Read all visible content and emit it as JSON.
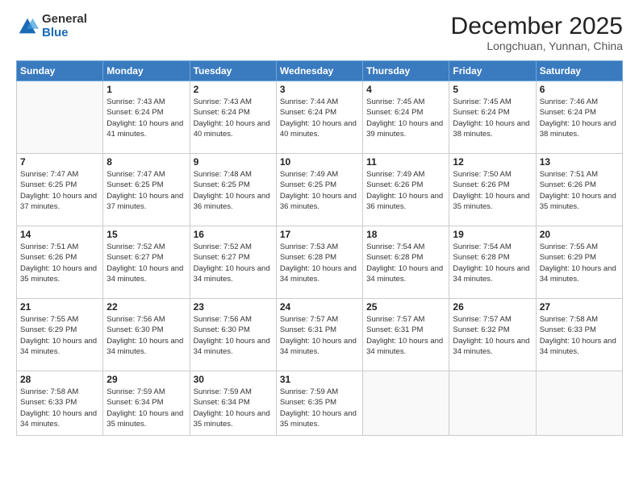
{
  "logo": {
    "general": "General",
    "blue": "Blue"
  },
  "header": {
    "month": "December 2025",
    "location": "Longchuan, Yunnan, China"
  },
  "weekdays": [
    "Sunday",
    "Monday",
    "Tuesday",
    "Wednesday",
    "Thursday",
    "Friday",
    "Saturday"
  ],
  "weeks": [
    [
      {
        "day": "",
        "sunrise": "",
        "sunset": "",
        "daylight": ""
      },
      {
        "day": "1",
        "sunrise": "Sunrise: 7:43 AM",
        "sunset": "Sunset: 6:24 PM",
        "daylight": "Daylight: 10 hours and 41 minutes."
      },
      {
        "day": "2",
        "sunrise": "Sunrise: 7:43 AM",
        "sunset": "Sunset: 6:24 PM",
        "daylight": "Daylight: 10 hours and 40 minutes."
      },
      {
        "day": "3",
        "sunrise": "Sunrise: 7:44 AM",
        "sunset": "Sunset: 6:24 PM",
        "daylight": "Daylight: 10 hours and 40 minutes."
      },
      {
        "day": "4",
        "sunrise": "Sunrise: 7:45 AM",
        "sunset": "Sunset: 6:24 PM",
        "daylight": "Daylight: 10 hours and 39 minutes."
      },
      {
        "day": "5",
        "sunrise": "Sunrise: 7:45 AM",
        "sunset": "Sunset: 6:24 PM",
        "daylight": "Daylight: 10 hours and 38 minutes."
      },
      {
        "day": "6",
        "sunrise": "Sunrise: 7:46 AM",
        "sunset": "Sunset: 6:24 PM",
        "daylight": "Daylight: 10 hours and 38 minutes."
      }
    ],
    [
      {
        "day": "7",
        "sunrise": "Sunrise: 7:47 AM",
        "sunset": "Sunset: 6:25 PM",
        "daylight": "Daylight: 10 hours and 37 minutes."
      },
      {
        "day": "8",
        "sunrise": "Sunrise: 7:47 AM",
        "sunset": "Sunset: 6:25 PM",
        "daylight": "Daylight: 10 hours and 37 minutes."
      },
      {
        "day": "9",
        "sunrise": "Sunrise: 7:48 AM",
        "sunset": "Sunset: 6:25 PM",
        "daylight": "Daylight: 10 hours and 36 minutes."
      },
      {
        "day": "10",
        "sunrise": "Sunrise: 7:49 AM",
        "sunset": "Sunset: 6:25 PM",
        "daylight": "Daylight: 10 hours and 36 minutes."
      },
      {
        "day": "11",
        "sunrise": "Sunrise: 7:49 AM",
        "sunset": "Sunset: 6:26 PM",
        "daylight": "Daylight: 10 hours and 36 minutes."
      },
      {
        "day": "12",
        "sunrise": "Sunrise: 7:50 AM",
        "sunset": "Sunset: 6:26 PM",
        "daylight": "Daylight: 10 hours and 35 minutes."
      },
      {
        "day": "13",
        "sunrise": "Sunrise: 7:51 AM",
        "sunset": "Sunset: 6:26 PM",
        "daylight": "Daylight: 10 hours and 35 minutes."
      }
    ],
    [
      {
        "day": "14",
        "sunrise": "Sunrise: 7:51 AM",
        "sunset": "Sunset: 6:26 PM",
        "daylight": "Daylight: 10 hours and 35 minutes."
      },
      {
        "day": "15",
        "sunrise": "Sunrise: 7:52 AM",
        "sunset": "Sunset: 6:27 PM",
        "daylight": "Daylight: 10 hours and 34 minutes."
      },
      {
        "day": "16",
        "sunrise": "Sunrise: 7:52 AM",
        "sunset": "Sunset: 6:27 PM",
        "daylight": "Daylight: 10 hours and 34 minutes."
      },
      {
        "day": "17",
        "sunrise": "Sunrise: 7:53 AM",
        "sunset": "Sunset: 6:28 PM",
        "daylight": "Daylight: 10 hours and 34 minutes."
      },
      {
        "day": "18",
        "sunrise": "Sunrise: 7:54 AM",
        "sunset": "Sunset: 6:28 PM",
        "daylight": "Daylight: 10 hours and 34 minutes."
      },
      {
        "day": "19",
        "sunrise": "Sunrise: 7:54 AM",
        "sunset": "Sunset: 6:28 PM",
        "daylight": "Daylight: 10 hours and 34 minutes."
      },
      {
        "day": "20",
        "sunrise": "Sunrise: 7:55 AM",
        "sunset": "Sunset: 6:29 PM",
        "daylight": "Daylight: 10 hours and 34 minutes."
      }
    ],
    [
      {
        "day": "21",
        "sunrise": "Sunrise: 7:55 AM",
        "sunset": "Sunset: 6:29 PM",
        "daylight": "Daylight: 10 hours and 34 minutes."
      },
      {
        "day": "22",
        "sunrise": "Sunrise: 7:56 AM",
        "sunset": "Sunset: 6:30 PM",
        "daylight": "Daylight: 10 hours and 34 minutes."
      },
      {
        "day": "23",
        "sunrise": "Sunrise: 7:56 AM",
        "sunset": "Sunset: 6:30 PM",
        "daylight": "Daylight: 10 hours and 34 minutes."
      },
      {
        "day": "24",
        "sunrise": "Sunrise: 7:57 AM",
        "sunset": "Sunset: 6:31 PM",
        "daylight": "Daylight: 10 hours and 34 minutes."
      },
      {
        "day": "25",
        "sunrise": "Sunrise: 7:57 AM",
        "sunset": "Sunset: 6:31 PM",
        "daylight": "Daylight: 10 hours and 34 minutes."
      },
      {
        "day": "26",
        "sunrise": "Sunrise: 7:57 AM",
        "sunset": "Sunset: 6:32 PM",
        "daylight": "Daylight: 10 hours and 34 minutes."
      },
      {
        "day": "27",
        "sunrise": "Sunrise: 7:58 AM",
        "sunset": "Sunset: 6:33 PM",
        "daylight": "Daylight: 10 hours and 34 minutes."
      }
    ],
    [
      {
        "day": "28",
        "sunrise": "Sunrise: 7:58 AM",
        "sunset": "Sunset: 6:33 PM",
        "daylight": "Daylight: 10 hours and 34 minutes."
      },
      {
        "day": "29",
        "sunrise": "Sunrise: 7:59 AM",
        "sunset": "Sunset: 6:34 PM",
        "daylight": "Daylight: 10 hours and 35 minutes."
      },
      {
        "day": "30",
        "sunrise": "Sunrise: 7:59 AM",
        "sunset": "Sunset: 6:34 PM",
        "daylight": "Daylight: 10 hours and 35 minutes."
      },
      {
        "day": "31",
        "sunrise": "Sunrise: 7:59 AM",
        "sunset": "Sunset: 6:35 PM",
        "daylight": "Daylight: 10 hours and 35 minutes."
      },
      {
        "day": "",
        "sunrise": "",
        "sunset": "",
        "daylight": ""
      },
      {
        "day": "",
        "sunrise": "",
        "sunset": "",
        "daylight": ""
      },
      {
        "day": "",
        "sunrise": "",
        "sunset": "",
        "daylight": ""
      }
    ]
  ]
}
